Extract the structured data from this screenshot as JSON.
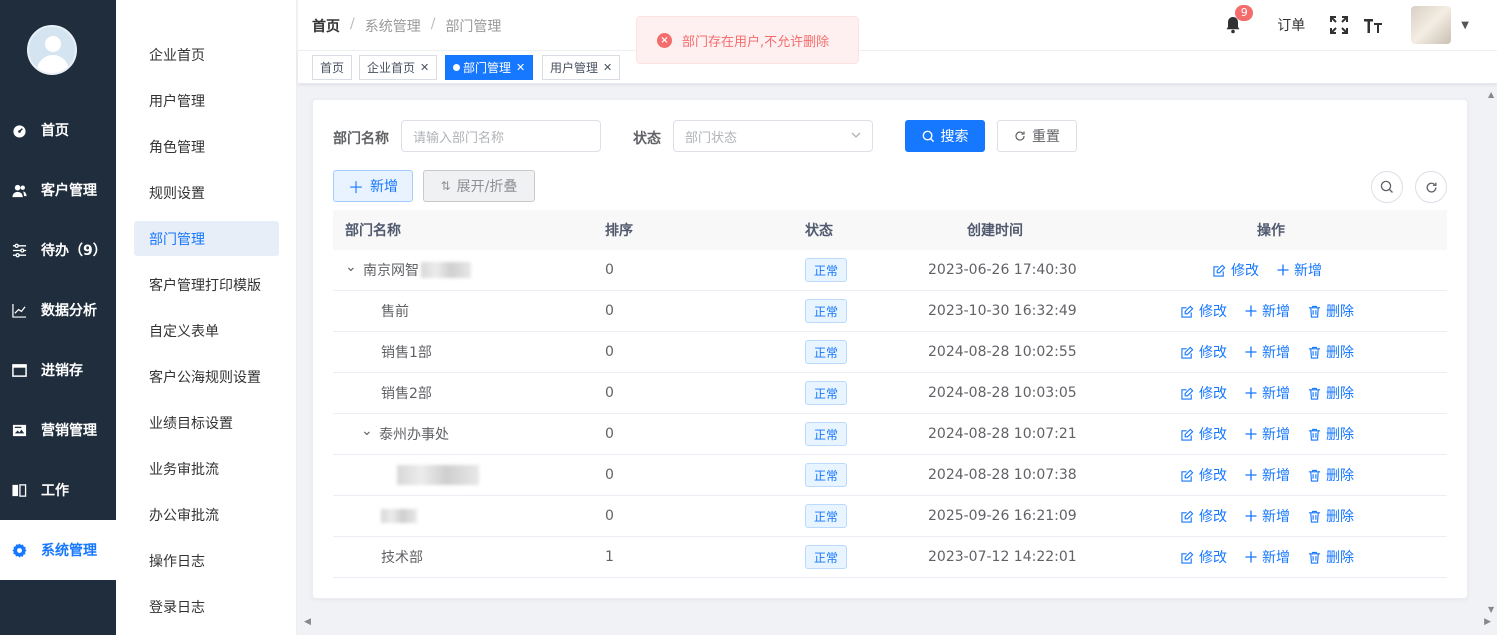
{
  "nav": {
    "items": [
      {
        "label": "首页",
        "icon": "dashboard-icon"
      },
      {
        "label": "客户管理",
        "icon": "users-icon"
      },
      {
        "label": "待办（9）",
        "icon": "sliders-icon"
      },
      {
        "label": "数据分析",
        "icon": "line-chart-icon"
      },
      {
        "label": "进销存",
        "icon": "window-icon"
      },
      {
        "label": "营销管理",
        "icon": "image-card-icon"
      },
      {
        "label": "工作",
        "icon": "book-icon"
      },
      {
        "label": "系统管理",
        "icon": "gear-icon",
        "active": true
      }
    ]
  },
  "submenu": {
    "items": [
      "企业首页",
      "用户管理",
      "角色管理",
      "规则设置",
      "部门管理",
      "客户管理打印模版",
      "自定义表单",
      "客户公海规则设置",
      "业绩目标设置",
      "业务审批流",
      "办公审批流",
      "操作日志",
      "登录日志"
    ],
    "active_index": 4
  },
  "header": {
    "breadcrumb": [
      "首页",
      "系统管理",
      "部门管理"
    ],
    "notification_count": "9",
    "order_label": "订单"
  },
  "tags": [
    {
      "label": "首页",
      "closable": false,
      "active": false
    },
    {
      "label": "企业首页",
      "closable": true,
      "active": false
    },
    {
      "label": "部门管理",
      "closable": true,
      "active": true
    },
    {
      "label": "用户管理",
      "closable": true,
      "active": false
    }
  ],
  "toast": {
    "message": "部门存在用户,不允许删除",
    "type": "error",
    "color": "#f56c6c"
  },
  "search": {
    "dept_name_label": "部门名称",
    "dept_name_placeholder": "请输入部门名称",
    "status_label": "状态",
    "status_placeholder": "部门状态",
    "search_button": "搜索",
    "reset_button": "重置"
  },
  "toolbar": {
    "add_button": "新增",
    "expand_button": "展开/折叠"
  },
  "table": {
    "columns": [
      "部门名称",
      "排序",
      "状态",
      "创建时间",
      "操作"
    ],
    "rows": [
      {
        "name": "南京网智",
        "sort": "0",
        "status": "正常",
        "created": "2023-06-26 17:40:30",
        "level": 0,
        "expandable": true,
        "ops": [
          "修改",
          "新增"
        ]
      },
      {
        "name": "售前",
        "sort": "0",
        "status": "正常",
        "created": "2023-10-30 16:32:49",
        "level": 1,
        "expandable": false,
        "ops": [
          "修改",
          "新增",
          "删除"
        ]
      },
      {
        "name": "销售1部",
        "sort": "0",
        "status": "正常",
        "created": "2024-08-28 10:02:55",
        "level": 1,
        "expandable": false,
        "ops": [
          "修改",
          "新增",
          "删除"
        ]
      },
      {
        "name": "销售2部",
        "sort": "0",
        "status": "正常",
        "created": "2024-08-28 10:03:05",
        "level": 1,
        "expandable": false,
        "ops": [
          "修改",
          "新增",
          "删除"
        ]
      },
      {
        "name": "泰州办事处",
        "sort": "0",
        "status": "正常",
        "created": "2024-08-28 10:07:21",
        "level": 1,
        "expandable": true,
        "ops": [
          "修改",
          "新增",
          "删除"
        ]
      },
      {
        "name": "",
        "sort": "0",
        "status": "正常",
        "created": "2024-08-28 10:07:38",
        "level": 2,
        "expandable": false,
        "blurred": true,
        "ops": [
          "修改",
          "新增",
          "删除"
        ]
      },
      {
        "name": "",
        "sort": "0",
        "status": "正常",
        "created": "2025-09-26 16:21:09",
        "level": 1,
        "expandable": false,
        "blurred": true,
        "ops": [
          "修改",
          "新增",
          "删除"
        ]
      },
      {
        "name": "技术部",
        "sort": "1",
        "status": "正常",
        "created": "2023-07-12 14:22:01",
        "level": 1,
        "expandable": false,
        "ops": [
          "修改",
          "新增",
          "删除"
        ]
      }
    ]
  },
  "colors": {
    "primary": "#1677ff",
    "nav_bg": "#1f2d3d",
    "danger": "#f56c6c"
  }
}
